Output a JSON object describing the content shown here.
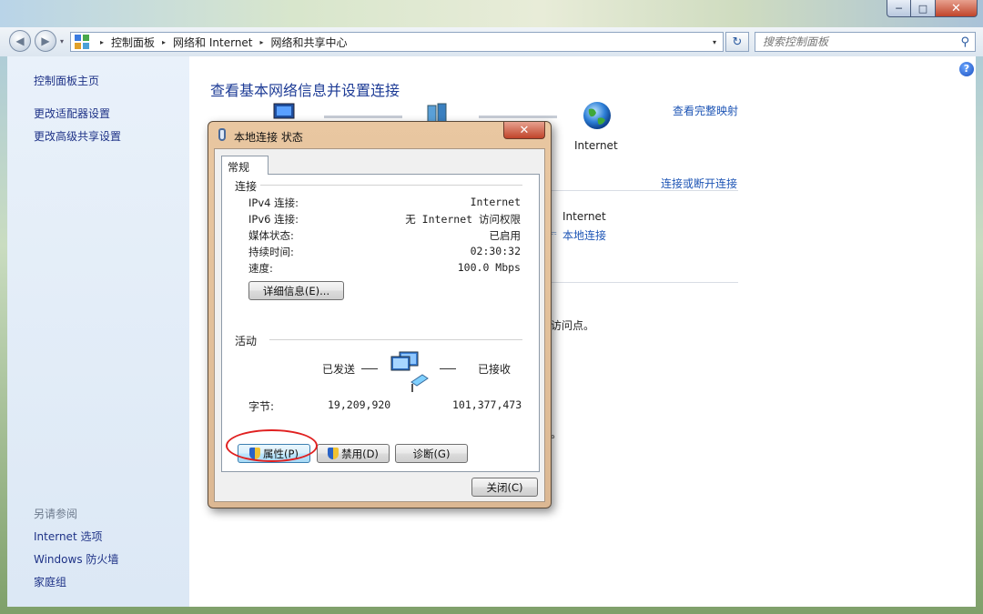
{
  "window": {
    "minimize_glyph": "─",
    "maximize_glyph": "□",
    "close_glyph": "✕"
  },
  "nav": {
    "back_glyph": "◀",
    "forward_glyph": "▶",
    "dropdown_glyph": "▾"
  },
  "address": {
    "crumbs": [
      "控制面板",
      "网络和 Internet",
      "网络和共享中心"
    ],
    "separator": "▸",
    "dropdown_glyph": "▾"
  },
  "refresh_glyph": "↻",
  "search": {
    "placeholder": "搜索控制面板",
    "icon_glyph": "⚲"
  },
  "sidebar": {
    "links": [
      "控制面板主页",
      "更改适配器设置",
      "更改高级共享设置"
    ],
    "see_also_heading": "另请参阅",
    "see_also_links": [
      "Internet 选项",
      "Windows 防火墙",
      "家庭组"
    ]
  },
  "main": {
    "title": "查看基本网络信息并设置连接",
    "view_full_map": "查看完整映射",
    "internet_label": "Internet",
    "connect_disconnect": "连接或断开连接",
    "access_type_value": "Internet",
    "connection_link": "本地连接",
    "partial_text_1": "访问点。",
    "partial_text_2": "。"
  },
  "dialog": {
    "title": "本地连接 状态",
    "close_glyph": "✕",
    "tab_general": "常规",
    "connection_heading": "连接",
    "rows": [
      {
        "key": "IPv4 连接:",
        "value": "Internet"
      },
      {
        "key": "IPv6 连接:",
        "value": "无 Internet 访问权限"
      },
      {
        "key": "媒体状态:",
        "value": "已启用"
      },
      {
        "key": "持续时间:",
        "value": "02:30:32"
      },
      {
        "key": "速度:",
        "value": "100.0 Mbps"
      }
    ],
    "details_button": "详细信息(E)...",
    "activity_heading": "活动",
    "sent_label": "已发送",
    "received_label": "已接收",
    "bytes_label": "字节:",
    "bytes_sent": "19,209,920",
    "bytes_received": "101,377,473",
    "properties_button": "属性(P)",
    "disable_button": "禁用(D)",
    "diagnose_button": "诊断(G)",
    "close_button": "关闭(C)"
  },
  "colors": {
    "link_blue": "#1e55b5",
    "title_blue": "#1e3c96",
    "annotation_red": "#e02020",
    "dialog_frame": "#e6c39d"
  }
}
